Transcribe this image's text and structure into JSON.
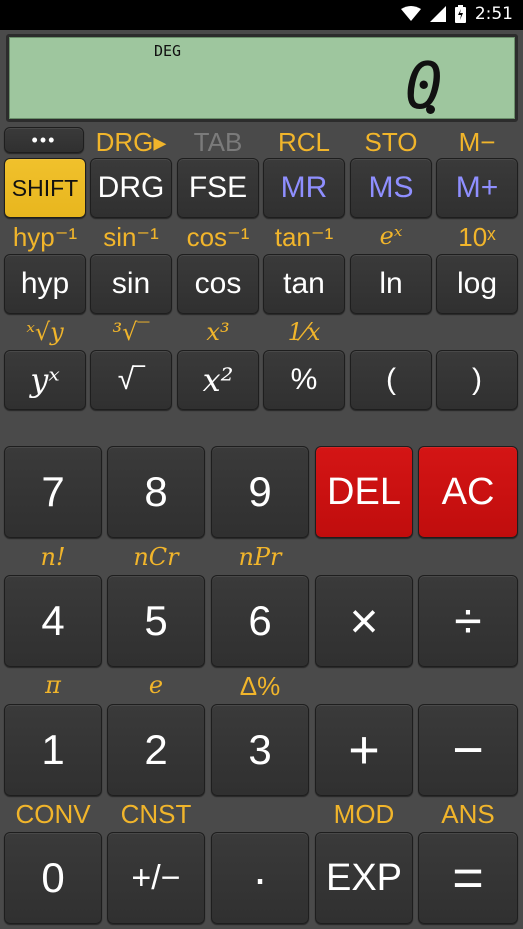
{
  "status_bar": {
    "time": "2:51"
  },
  "display": {
    "mode": "DEG",
    "value": "0"
  },
  "shift_labels": {
    "row1": [
      "DRG▸",
      "TAB",
      "RCL",
      "STO",
      "M−"
    ],
    "row2": [
      "hyp⁻¹",
      "sin⁻¹",
      "cos⁻¹",
      "tan⁻¹",
      "eˣ",
      "10ˣ"
    ],
    "row3": [
      "ˣ√y",
      "³√‾",
      "x³",
      "1⁄x"
    ],
    "num1": [
      "n!",
      "nCr",
      "nPr"
    ],
    "num2": [
      "π",
      "e",
      "Δ%"
    ],
    "num3": [
      "CONV",
      "CNST",
      "MOD",
      "ANS"
    ]
  },
  "buttons": {
    "menu": "•••",
    "row1": [
      "SHIFT",
      "DRG",
      "FSE",
      "MR",
      "MS",
      "M+"
    ],
    "row2": [
      "hyp",
      "sin",
      "cos",
      "tan",
      "ln",
      "log"
    ],
    "row3": [
      "yˣ",
      "√‾",
      "x²",
      "%",
      "(",
      ")"
    ],
    "row4": [
      "7",
      "8",
      "9",
      "DEL",
      "AC"
    ],
    "row5": [
      "4",
      "5",
      "6",
      "×",
      "÷"
    ],
    "row6": [
      "1",
      "2",
      "3",
      "+",
      "−"
    ],
    "row7": [
      "0",
      "+/−",
      "·",
      "EXP",
      "="
    ]
  },
  "colors": {
    "shift": "#e8b61e",
    "label": "#f1b52b",
    "danger": "#cc1111",
    "memory": "#8f8fff",
    "lcd": "#9ec69e"
  }
}
